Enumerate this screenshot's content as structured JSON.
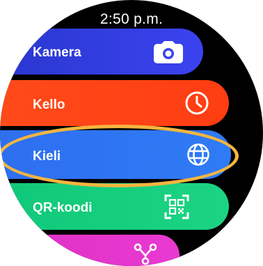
{
  "status_bar": {
    "time": "2:50 p.m."
  },
  "apps": [
    {
      "label": "Kamera",
      "icon": "camera-icon",
      "color": "#3a43ef"
    },
    {
      "label": "Kello",
      "icon": "clock-icon",
      "color": "#ff3d12"
    },
    {
      "label": "Kieli",
      "icon": "globe-icon",
      "color": "#2f7bf5",
      "highlighted": true
    },
    {
      "label": "QR-koodi",
      "icon": "qr-code-icon",
      "color": "#1bd483"
    },
    {
      "label": "",
      "icon": "share-icon",
      "color": "#e83ad2"
    }
  ],
  "highlight_color": "#f4b53f"
}
